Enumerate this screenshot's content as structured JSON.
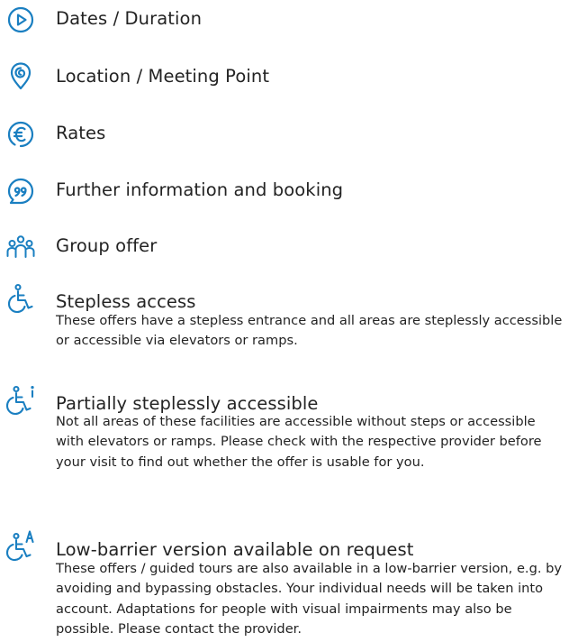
{
  "accent_color": "#1a7fc1",
  "items": [
    {
      "icon": "play-circle-icon",
      "title": "Dates / Duration",
      "description": ""
    },
    {
      "icon": "location-pin-icon",
      "title": "Location / Meeting Point",
      "description": ""
    },
    {
      "icon": "euro-circle-icon",
      "title": "Rates",
      "description": ""
    },
    {
      "icon": "speech-bubble-icon",
      "title": "Further information and booking",
      "description": ""
    },
    {
      "icon": "group-icon",
      "title": "Group offer",
      "description": ""
    },
    {
      "icon": "wheelchair-icon",
      "title": "Stepless access",
      "description": "These offers have a stepless entrance and all areas are steplessly accessible or accessible via elevators or ramps."
    },
    {
      "icon": "wheelchair-info-icon",
      "title": "Partially steplessly accessible",
      "description": "Not all areas of these facilities are accessible without steps or accessible with elevators or ramps. Please check with the respective provider before your visit to find out whether the offer is usable for you."
    },
    {
      "icon": "wheelchair-a-icon",
      "title": "Low-barrier version available on request",
      "description": "These offers / guided tours are also available in a low-barrier version, e.g. by avoiding and bypassing obstacles. Your individual needs will be taken into account. Adaptations for people with visual impairments may also be possible. Please contact the provider."
    }
  ]
}
